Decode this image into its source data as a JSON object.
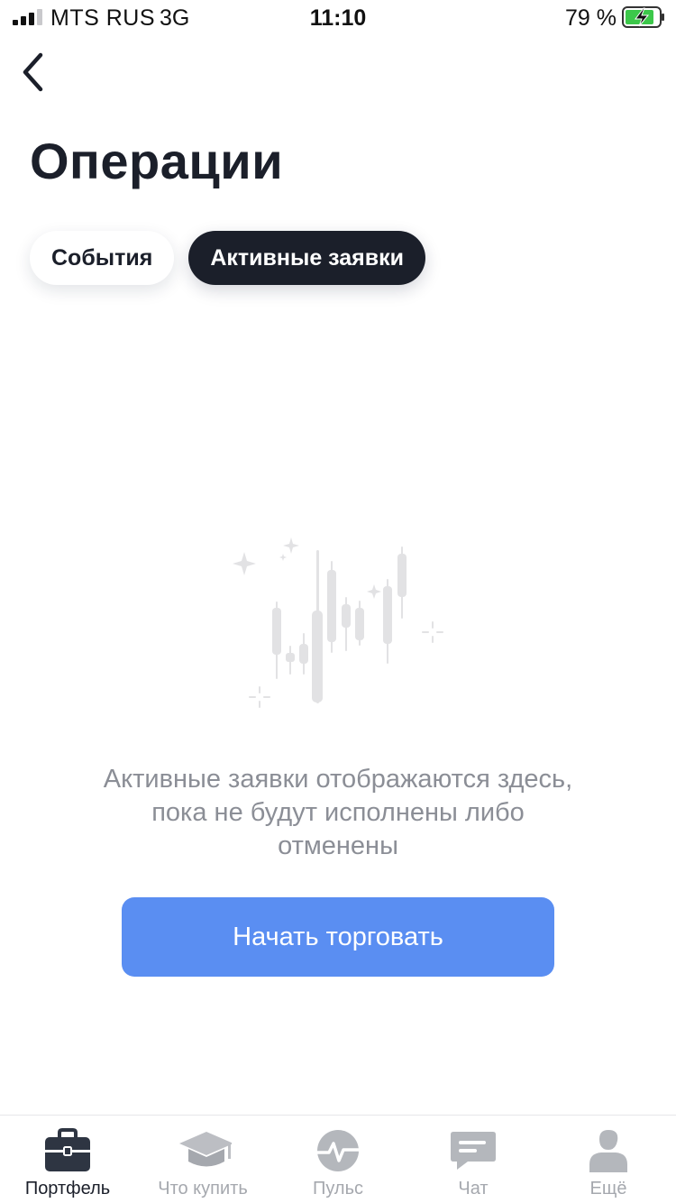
{
  "status_bar": {
    "carrier": "MTS RUS",
    "network": "3G",
    "time": "11:10",
    "battery": "79 %"
  },
  "page": {
    "title": "Операции"
  },
  "tabs": [
    {
      "label": "События",
      "active": false
    },
    {
      "label": "Активные заявки",
      "active": true
    }
  ],
  "empty_state": {
    "illustration_icon": "candlestick-chart-icon",
    "message_lines": [
      "Активные заявки отображаются здесь,",
      "пока не будут исполнены либо",
      "отменены"
    ],
    "button_label": "Начать торговать"
  },
  "bottom_nav": [
    {
      "label": "Портфель",
      "icon": "briefcase-icon",
      "active": true
    },
    {
      "label": "Что купить",
      "icon": "graduation-cap-icon",
      "active": false
    },
    {
      "label": "Пульс",
      "icon": "pulse-icon",
      "active": false
    },
    {
      "label": "Чат",
      "icon": "chat-icon",
      "active": false
    },
    {
      "label": "Ещё",
      "icon": "user-icon",
      "active": false
    }
  ],
  "colors": {
    "primary_dark": "#1b1f2a",
    "accent_blue": "#5a8ef2",
    "muted_text": "#8b8e96",
    "nav_inactive": "#a5a8ae"
  }
}
